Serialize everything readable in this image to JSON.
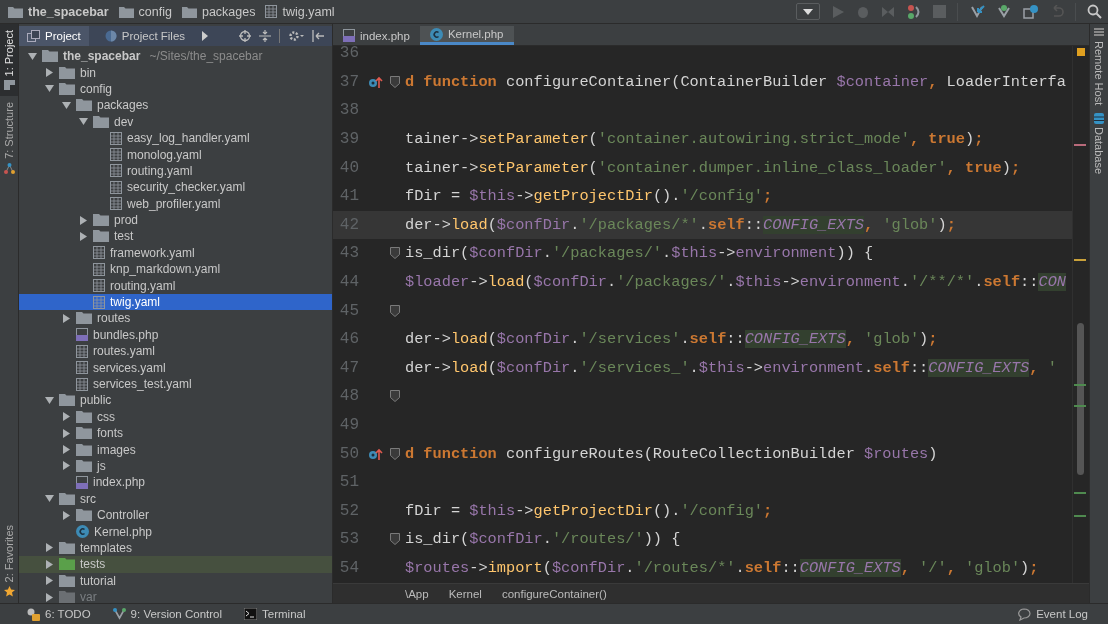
{
  "breadcrumbs": [
    {
      "label": "the_spacebar",
      "kind": "project"
    },
    {
      "label": "config",
      "kind": "folder"
    },
    {
      "label": "packages",
      "kind": "folder"
    },
    {
      "label": "twig.yaml",
      "kind": "yaml"
    }
  ],
  "left_strip": [
    {
      "label": "1: Project",
      "selected": true,
      "kind": "project"
    },
    {
      "label": "7: Structure",
      "selected": false,
      "kind": "structure"
    },
    {
      "label": "2: Favorites",
      "selected": false,
      "kind": "favorites"
    }
  ],
  "project": {
    "tabs": [
      {
        "label": "Project",
        "selected": true,
        "kind": "project"
      },
      {
        "label": "Project Files",
        "selected": false,
        "kind": "files"
      }
    ],
    "tree": [
      {
        "name": "the_spacebar",
        "path": "~/Sites/the_spacebar",
        "kind": "folder",
        "expanded": true,
        "selected": false,
        "children": [
          {
            "name": "bin",
            "kind": "folder",
            "expanded": false,
            "selected": false
          },
          {
            "name": "config",
            "kind": "folder",
            "expanded": true,
            "selected": false,
            "children": [
              {
                "name": "packages",
                "kind": "folder",
                "expanded": true,
                "selected": false,
                "children": [
                  {
                    "name": "dev",
                    "kind": "folder",
                    "expanded": true,
                    "selected": false,
                    "children": [
                      {
                        "name": "easy_log_handler.yaml",
                        "kind": "yaml",
                        "selected": false
                      },
                      {
                        "name": "monolog.yaml",
                        "kind": "yaml",
                        "selected": false
                      },
                      {
                        "name": "routing.yaml",
                        "kind": "yaml",
                        "selected": false
                      },
                      {
                        "name": "security_checker.yaml",
                        "kind": "yaml",
                        "selected": false
                      },
                      {
                        "name": "web_profiler.yaml",
                        "kind": "yaml",
                        "selected": false
                      }
                    ]
                  },
                  {
                    "name": "prod",
                    "kind": "folder",
                    "expanded": false,
                    "selected": false
                  },
                  {
                    "name": "test",
                    "kind": "folder",
                    "expanded": false,
                    "selected": false
                  },
                  {
                    "name": "framework.yaml",
                    "kind": "yaml",
                    "selected": false
                  },
                  {
                    "name": "knp_markdown.yaml",
                    "kind": "yaml",
                    "selected": false
                  },
                  {
                    "name": "routing.yaml",
                    "kind": "yaml",
                    "selected": false
                  },
                  {
                    "name": "twig.yaml",
                    "kind": "yaml",
                    "selected": true
                  }
                ]
              },
              {
                "name": "routes",
                "kind": "folder",
                "expanded": false,
                "selected": false
              },
              {
                "name": "bundles.php",
                "kind": "php",
                "selected": false
              },
              {
                "name": "routes.yaml",
                "kind": "yaml",
                "selected": false
              },
              {
                "name": "services.yaml",
                "kind": "yaml",
                "selected": false
              },
              {
                "name": "services_test.yaml",
                "kind": "yaml",
                "selected": false
              }
            ]
          },
          {
            "name": "public",
            "kind": "folder",
            "expanded": true,
            "selected": false,
            "children": [
              {
                "name": "css",
                "kind": "folder",
                "expanded": false,
                "selected": false
              },
              {
                "name": "fonts",
                "kind": "folder",
                "expanded": false,
                "selected": false
              },
              {
                "name": "images",
                "kind": "folder",
                "expanded": false,
                "selected": false
              },
              {
                "name": "js",
                "kind": "folder",
                "expanded": false,
                "selected": false
              },
              {
                "name": "index.php",
                "kind": "php",
                "selected": false
              }
            ]
          },
          {
            "name": "src",
            "kind": "folder",
            "expanded": true,
            "selected": false,
            "children": [
              {
                "name": "Controller",
                "kind": "folder",
                "expanded": false,
                "selected": false
              },
              {
                "name": "Kernel.php",
                "kind": "class",
                "selected": false
              }
            ]
          },
          {
            "name": "templates",
            "kind": "folder",
            "expanded": false,
            "selected": false
          },
          {
            "name": "tests",
            "kind": "test-folder",
            "expanded": false,
            "selected": false
          },
          {
            "name": "tutorial",
            "kind": "folder",
            "expanded": false,
            "selected": false
          },
          {
            "name": "var",
            "kind": "excluded-folder",
            "expanded": false,
            "selected": false
          }
        ]
      }
    ]
  },
  "editor": {
    "tabs": [
      {
        "label": "index.php",
        "kind": "php",
        "selected": false
      },
      {
        "label": "Kernel.php",
        "kind": "class",
        "selected": true
      }
    ],
    "lines": [
      {
        "number": "36",
        "override": false,
        "fold": false,
        "current": false
      },
      {
        "number": "37",
        "override": true,
        "fold": true,
        "current": false,
        "tokens": [
          {
            "kind": "kw",
            "text": "d function "
          },
          {
            "kind": "plain",
            "text": "configureContainer(ContainerBuilder "
          },
          {
            "kind": "var",
            "text": "$container"
          },
          {
            "kind": "kw",
            "text": ", "
          },
          {
            "kind": "plain",
            "text": "LoaderInterfa"
          }
        ]
      },
      {
        "number": "38",
        "override": false,
        "fold": false,
        "current": false
      },
      {
        "number": "39",
        "override": false,
        "fold": false,
        "current": false,
        "tokens": [
          {
            "kind": "plain",
            "text": "tainer->"
          },
          {
            "kind": "fn",
            "text": "setParameter"
          },
          {
            "kind": "plain",
            "text": "("
          },
          {
            "kind": "str",
            "text": "'container.autowiring.strict_mode'"
          },
          {
            "kind": "kw",
            "text": ", true"
          },
          {
            "kind": "plain",
            "text": ")"
          },
          {
            "kind": "kw",
            "text": ";"
          }
        ]
      },
      {
        "number": "40",
        "override": false,
        "fold": false,
        "current": false,
        "tokens": [
          {
            "kind": "plain",
            "text": "tainer->"
          },
          {
            "kind": "fn",
            "text": "setParameter"
          },
          {
            "kind": "plain",
            "text": "("
          },
          {
            "kind": "str",
            "text": "'container.dumper.inline_class_loader'"
          },
          {
            "kind": "kw",
            "text": ", true"
          },
          {
            "kind": "plain",
            "text": ")"
          },
          {
            "kind": "kw",
            "text": ";"
          }
        ]
      },
      {
        "number": "41",
        "override": false,
        "fold": false,
        "current": false,
        "tokens": [
          {
            "kind": "plain",
            "text": "fDir = "
          },
          {
            "kind": "var",
            "text": "$this"
          },
          {
            "kind": "plain",
            "text": "->"
          },
          {
            "kind": "fn",
            "text": "getProjectDir"
          },
          {
            "kind": "plain",
            "text": "()."
          },
          {
            "kind": "str",
            "text": "'/config'"
          },
          {
            "kind": "kw",
            "text": ";"
          }
        ]
      },
      {
        "number": "42",
        "override": false,
        "fold": false,
        "current": true,
        "tokens": [
          {
            "kind": "plain",
            "text": "der->"
          },
          {
            "kind": "fn",
            "text": "load"
          },
          {
            "kind": "plain",
            "text": "("
          },
          {
            "kind": "var",
            "text": "$confDir"
          },
          {
            "kind": "plain",
            "text": "."
          },
          {
            "kind": "str",
            "text": "'/packages/*'"
          },
          {
            "kind": "plain",
            "text": "."
          },
          {
            "kind": "kw",
            "text": "self"
          },
          {
            "kind": "plain",
            "text": "::"
          },
          {
            "kind": "const",
            "text": "CONFIG_EXTS"
          },
          {
            "kind": "kw",
            "text": ", "
          },
          {
            "kind": "str",
            "text": "'glob'"
          },
          {
            "kind": "plain",
            "text": ")"
          },
          {
            "kind": "kw",
            "text": ";"
          }
        ]
      },
      {
        "number": "43",
        "override": false,
        "fold": true,
        "current": false,
        "tokens": [
          {
            "kind": "plain",
            "text": "is_dir("
          },
          {
            "kind": "var",
            "text": "$confDir"
          },
          {
            "kind": "plain",
            "text": "."
          },
          {
            "kind": "str",
            "text": "'/packages/'"
          },
          {
            "kind": "plain",
            "text": "."
          },
          {
            "kind": "var",
            "text": "$this"
          },
          {
            "kind": "plain",
            "text": "->"
          },
          {
            "kind": "var",
            "text": "environment"
          },
          {
            "kind": "plain",
            "text": ")) {"
          }
        ]
      },
      {
        "number": "44",
        "override": false,
        "fold": false,
        "current": false,
        "tokens": [
          {
            "kind": "var",
            "text": "$loader"
          },
          {
            "kind": "plain",
            "text": "->"
          },
          {
            "kind": "fn",
            "text": "load"
          },
          {
            "kind": "plain",
            "text": "("
          },
          {
            "kind": "var",
            "text": "$confDir"
          },
          {
            "kind": "plain",
            "text": "."
          },
          {
            "kind": "str",
            "text": "'/packages/'"
          },
          {
            "kind": "plain",
            "text": "."
          },
          {
            "kind": "var",
            "text": "$this"
          },
          {
            "kind": "plain",
            "text": "->"
          },
          {
            "kind": "var",
            "text": "environment"
          },
          {
            "kind": "plain",
            "text": "."
          },
          {
            "kind": "str",
            "text": "'/**/*'"
          },
          {
            "kind": "plain",
            "text": "."
          },
          {
            "kind": "kw",
            "text": "self"
          },
          {
            "kind": "plain",
            "text": "::"
          },
          {
            "kind": "const",
            "text": "CON"
          }
        ]
      },
      {
        "number": "45",
        "override": false,
        "fold": true,
        "current": false
      },
      {
        "number": "46",
        "override": false,
        "fold": false,
        "current": false,
        "tokens": [
          {
            "kind": "plain",
            "text": "der->"
          },
          {
            "kind": "fn",
            "text": "load"
          },
          {
            "kind": "plain",
            "text": "("
          },
          {
            "kind": "var",
            "text": "$confDir"
          },
          {
            "kind": "plain",
            "text": "."
          },
          {
            "kind": "str",
            "text": "'/services'"
          },
          {
            "kind": "plain",
            "text": "."
          },
          {
            "kind": "kw",
            "text": "self"
          },
          {
            "kind": "plain",
            "text": "::"
          },
          {
            "kind": "const",
            "text": "CONFIG_EXTS"
          },
          {
            "kind": "kw",
            "text": ", "
          },
          {
            "kind": "str",
            "text": "'glob'"
          },
          {
            "kind": "plain",
            "text": ")"
          },
          {
            "kind": "kw",
            "text": ";"
          }
        ]
      },
      {
        "number": "47",
        "override": false,
        "fold": false,
        "current": false,
        "tokens": [
          {
            "kind": "plain",
            "text": "der->"
          },
          {
            "kind": "fn",
            "text": "load"
          },
          {
            "kind": "plain",
            "text": "("
          },
          {
            "kind": "var",
            "text": "$confDir"
          },
          {
            "kind": "plain",
            "text": "."
          },
          {
            "kind": "str",
            "text": "'/services_'"
          },
          {
            "kind": "plain",
            "text": "."
          },
          {
            "kind": "var",
            "text": "$this"
          },
          {
            "kind": "plain",
            "text": "->"
          },
          {
            "kind": "var",
            "text": "environment"
          },
          {
            "kind": "plain",
            "text": "."
          },
          {
            "kind": "kw",
            "text": "self"
          },
          {
            "kind": "plain",
            "text": "::"
          },
          {
            "kind": "const",
            "text": "CONFIG_EXTS"
          },
          {
            "kind": "kw",
            "text": ", "
          },
          {
            "kind": "str",
            "text": "'"
          }
        ]
      },
      {
        "number": "48",
        "override": false,
        "fold": true,
        "current": false
      },
      {
        "number": "49",
        "override": false,
        "fold": false,
        "current": false
      },
      {
        "number": "50",
        "override": true,
        "fold": true,
        "current": false,
        "tokens": [
          {
            "kind": "kw",
            "text": "d function "
          },
          {
            "kind": "plain",
            "text": "configureRoutes(RouteCollectionBuilder "
          },
          {
            "kind": "var",
            "text": "$routes"
          },
          {
            "kind": "plain",
            "text": ")"
          }
        ]
      },
      {
        "number": "51",
        "override": false,
        "fold": false,
        "current": false
      },
      {
        "number": "52",
        "override": false,
        "fold": false,
        "current": false,
        "tokens": [
          {
            "kind": "plain",
            "text": "fDir = "
          },
          {
            "kind": "var",
            "text": "$this"
          },
          {
            "kind": "plain",
            "text": "->"
          },
          {
            "kind": "fn",
            "text": "getProjectDir"
          },
          {
            "kind": "plain",
            "text": "()."
          },
          {
            "kind": "str",
            "text": "'/config'"
          },
          {
            "kind": "kw",
            "text": ";"
          }
        ]
      },
      {
        "number": "53",
        "override": false,
        "fold": true,
        "current": false,
        "tokens": [
          {
            "kind": "plain",
            "text": "is_dir("
          },
          {
            "kind": "var",
            "text": "$confDir"
          },
          {
            "kind": "plain",
            "text": "."
          },
          {
            "kind": "str",
            "text": "'/routes/'"
          },
          {
            "kind": "plain",
            "text": ")) {"
          }
        ]
      },
      {
        "number": "54",
        "override": false,
        "fold": false,
        "current": false,
        "tokens": [
          {
            "kind": "var",
            "text": "$routes"
          },
          {
            "kind": "plain",
            "text": "->"
          },
          {
            "kind": "fn",
            "text": "import"
          },
          {
            "kind": "plain",
            "text": "("
          },
          {
            "kind": "var",
            "text": "$confDir"
          },
          {
            "kind": "plain",
            "text": "."
          },
          {
            "kind": "str",
            "text": "'/routes/*'"
          },
          {
            "kind": "plain",
            "text": "."
          },
          {
            "kind": "kw",
            "text": "self"
          },
          {
            "kind": "plain",
            "text": "::"
          },
          {
            "kind": "const",
            "text": "CONFIG_EXTS"
          },
          {
            "kind": "kw",
            "text": ", "
          },
          {
            "kind": "str",
            "text": "'/'"
          },
          {
            "kind": "kw",
            "text": ", "
          },
          {
            "kind": "str",
            "text": "'glob'"
          },
          {
            "kind": "plain",
            "text": ")"
          },
          {
            "kind": "kw",
            "text": ";"
          }
        ]
      }
    ],
    "breadcrumbs": [
      "\\App",
      "Kernel",
      "configureContainer()"
    ]
  },
  "right_strip": [
    {
      "label": "Remote Host",
      "kind": "remote"
    },
    {
      "label": "Database",
      "kind": "database"
    }
  ],
  "status_bar": {
    "tools": [
      {
        "label": "6: TODO",
        "kind": "todo"
      },
      {
        "label": "9: Version Control",
        "kind": "vcs"
      },
      {
        "label": "Terminal",
        "kind": "terminal"
      }
    ],
    "event_log": "Event Log"
  }
}
